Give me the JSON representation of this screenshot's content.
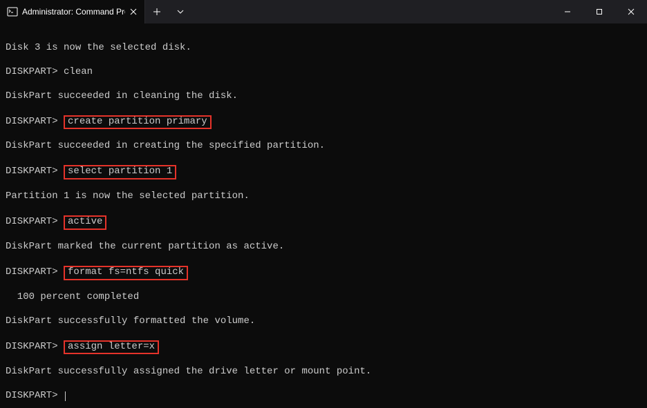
{
  "titlebar": {
    "tab_title": "Administrator: Command Prom"
  },
  "terminal": {
    "lines": [
      {
        "type": "blank"
      },
      {
        "type": "text",
        "content": "Disk 3 is now the selected disk."
      },
      {
        "type": "blank"
      },
      {
        "type": "prompt_cmd",
        "prompt": "DISKPART> ",
        "cmd": "clean",
        "hl": false
      },
      {
        "type": "blank"
      },
      {
        "type": "text",
        "content": "DiskPart succeeded in cleaning the disk."
      },
      {
        "type": "blank"
      },
      {
        "type": "prompt_cmd",
        "prompt": "DISKPART> ",
        "cmd": "create partition primary",
        "hl": true
      },
      {
        "type": "blank"
      },
      {
        "type": "text",
        "content": "DiskPart succeeded in creating the specified partition."
      },
      {
        "type": "blank"
      },
      {
        "type": "prompt_cmd",
        "prompt": "DISKPART> ",
        "cmd": "select partition 1",
        "hl": true
      },
      {
        "type": "blank"
      },
      {
        "type": "text",
        "content": "Partition 1 is now the selected partition."
      },
      {
        "type": "blank"
      },
      {
        "type": "prompt_cmd",
        "prompt": "DISKPART> ",
        "cmd": "active",
        "hl": true
      },
      {
        "type": "blank"
      },
      {
        "type": "text",
        "content": "DiskPart marked the current partition as active."
      },
      {
        "type": "blank"
      },
      {
        "type": "prompt_cmd",
        "prompt": "DISKPART> ",
        "cmd": "format fs=ntfs quick",
        "hl": true
      },
      {
        "type": "blank"
      },
      {
        "type": "text",
        "content": "  100 percent completed"
      },
      {
        "type": "blank"
      },
      {
        "type": "text",
        "content": "DiskPart successfully formatted the volume."
      },
      {
        "type": "blank"
      },
      {
        "type": "prompt_cmd",
        "prompt": "DISKPART> ",
        "cmd": "assign letter=x",
        "hl": true
      },
      {
        "type": "blank"
      },
      {
        "type": "text",
        "content": "DiskPart successfully assigned the drive letter or mount point."
      },
      {
        "type": "blank"
      },
      {
        "type": "prompt_cursor",
        "prompt": "DISKPART> "
      }
    ]
  }
}
